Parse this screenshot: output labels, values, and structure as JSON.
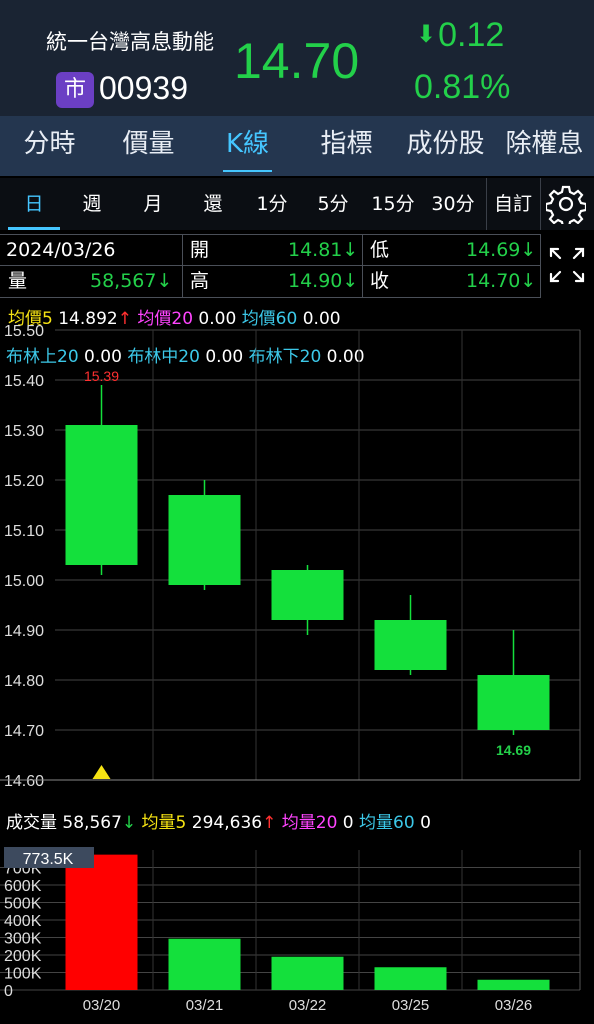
{
  "header": {
    "stock_name": "統一台灣高息動能",
    "market_badge": "市",
    "stock_code": "00939",
    "price": "14.70",
    "change_arrow": "⬇",
    "change": "0.12",
    "change_pct": "0.81%",
    "price_color": "#23d04a"
  },
  "tabs": [
    {
      "label": "分時"
    },
    {
      "label": "價量"
    },
    {
      "label": "K線",
      "active": true
    },
    {
      "label": "指標"
    },
    {
      "label": "成份股"
    },
    {
      "label": "除權息"
    }
  ],
  "periods": [
    "日",
    "週",
    "月",
    "還",
    "1分",
    "5分",
    "15分",
    "30分",
    "自訂"
  ],
  "active_period": "日",
  "settings_icon": "gear-icon",
  "expand_icon": "expand-icon",
  "info": {
    "date": "2024/03/26",
    "volume_label": "量",
    "volume_value": "58,567↓",
    "open_label": "開",
    "open_value": "14.81↓",
    "high_label": "高",
    "high_value": "14.90↓",
    "low_label": "低",
    "low_value": "14.69↓",
    "close_label": "收",
    "close_value": "14.70↓"
  },
  "ma_legend": {
    "ma5_label": "均價5",
    "ma5_value": "14.892",
    "ma5_arrow": "↑",
    "ma20_label": "均價20",
    "ma20_value": "0.00",
    "ma60_label": "均價60",
    "ma60_value": "0.00"
  },
  "boll_legend": {
    "upper_label": "布林上20",
    "upper_value": "0.00",
    "mid_label": "布林中20",
    "mid_value": "0.00",
    "lower_label": "布林下20",
    "lower_value": "0.00"
  },
  "vol_legend": {
    "vol_label": "成交量",
    "vol_value": "58,567",
    "vol_arrow": "↓",
    "mv5_label": "均量5",
    "mv5_value": "294,636",
    "mv5_arrow": "↑",
    "mv20_label": "均量20",
    "mv20_value": "0",
    "mv60_label": "均量60",
    "mv60_value": "0"
  },
  "chart_data": [
    {
      "type": "candlestick",
      "x": [
        "03/20",
        "03/21",
        "03/22",
        "03/25",
        "03/26"
      ],
      "open": [
        15.31,
        15.17,
        15.02,
        14.92,
        14.81
      ],
      "high": [
        15.39,
        15.2,
        15.03,
        14.97,
        14.9
      ],
      "low": [
        15.01,
        14.98,
        14.89,
        14.81,
        14.69
      ],
      "close": [
        15.03,
        14.99,
        14.92,
        14.82,
        14.7
      ],
      "yticks": [
        "15.50",
        "15.40",
        "15.30",
        "15.20",
        "15.10",
        "15.00",
        "14.90",
        "14.80",
        "14.70",
        "14.60"
      ],
      "ylim": [
        14.6,
        15.5
      ],
      "max_label": "15.39",
      "min_label": "14.69",
      "up_color": "#ff2020",
      "down_color": "#14e03c"
    },
    {
      "type": "bar",
      "categories": [
        "03/20",
        "03/21",
        "03/22",
        "03/25",
        "03/26"
      ],
      "values": [
        773500,
        293000,
        190000,
        130000,
        58567
      ],
      "colors": [
        "#ff0000",
        "#14e03c",
        "#14e03c",
        "#14e03c",
        "#14e03c"
      ],
      "yticks": [
        "700K",
        "600K",
        "500K",
        "400K",
        "300K",
        "200K",
        "100K",
        "0"
      ],
      "ylim": [
        0,
        800000
      ],
      "max_label": "773.5K"
    }
  ]
}
